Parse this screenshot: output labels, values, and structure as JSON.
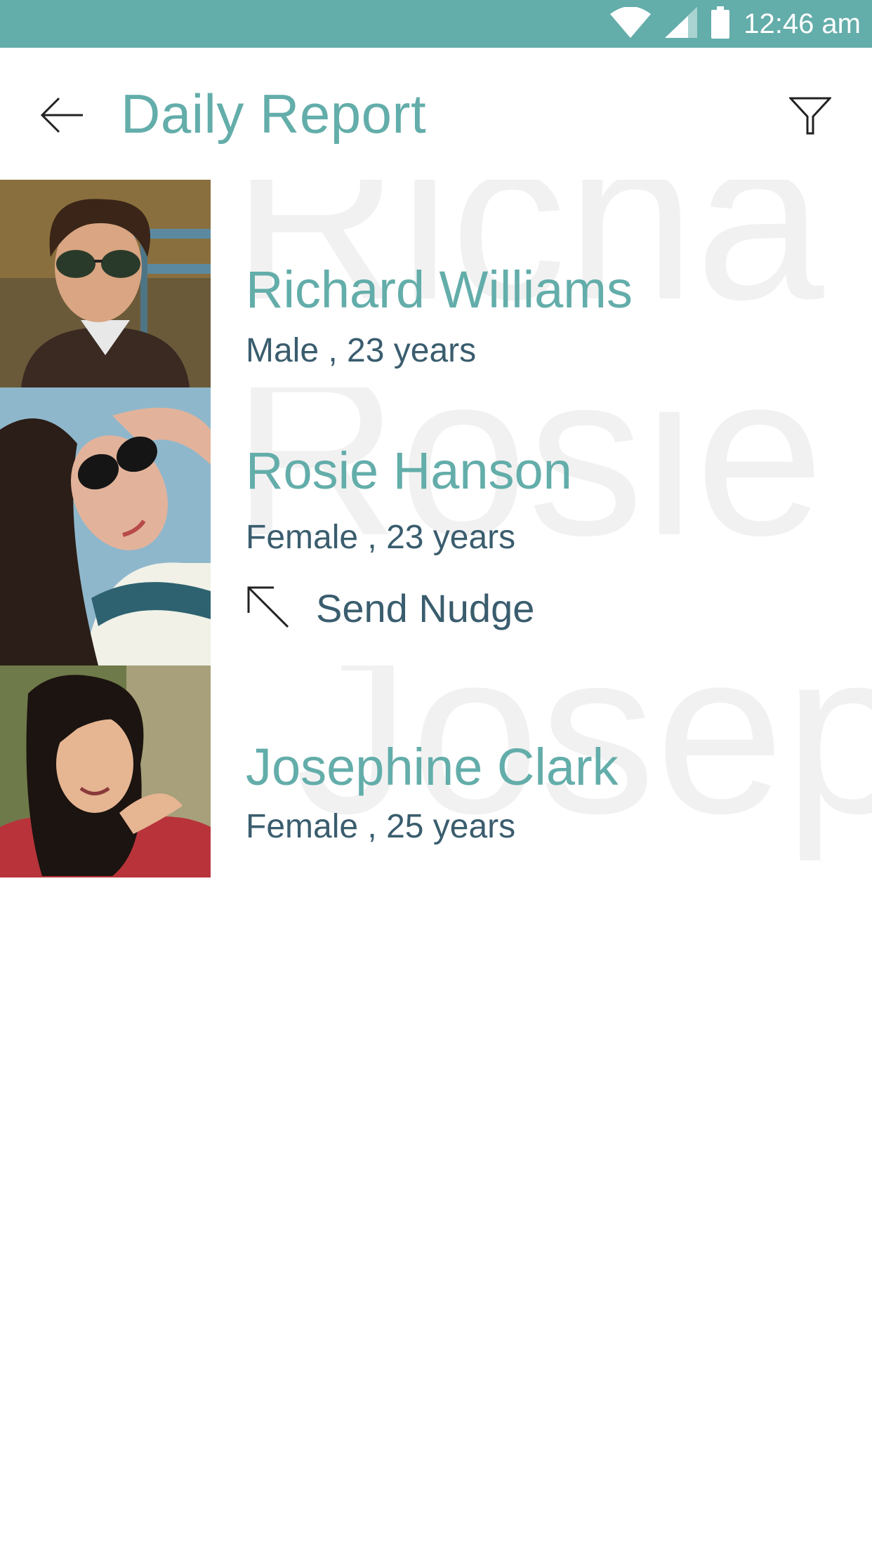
{
  "status_bar": {
    "time": "12:46 am",
    "icons": [
      "wifi-icon",
      "signal-icon",
      "battery-icon"
    ]
  },
  "header": {
    "title": "Daily Report",
    "back_icon": "arrow-left-icon",
    "filter_icon": "filter-icon"
  },
  "people": [
    {
      "name": "Richard Williams",
      "bg_name": "Richa",
      "details": "Male , 23 years"
    },
    {
      "name": "Rosie Hanson",
      "bg_name": "Rosie",
      "details": "Female , 23 years",
      "action": {
        "label": "Send Nudge",
        "icon": "arrow-up-left-icon"
      }
    },
    {
      "name": "Josephine Clark",
      "bg_name": "Josep",
      "details": "Female , 25 years"
    }
  ],
  "colors": {
    "accent": "#63adaa",
    "text_dark": "#3a5d6e",
    "watermark": "#f1f1f1",
    "background": "#ffffff"
  }
}
